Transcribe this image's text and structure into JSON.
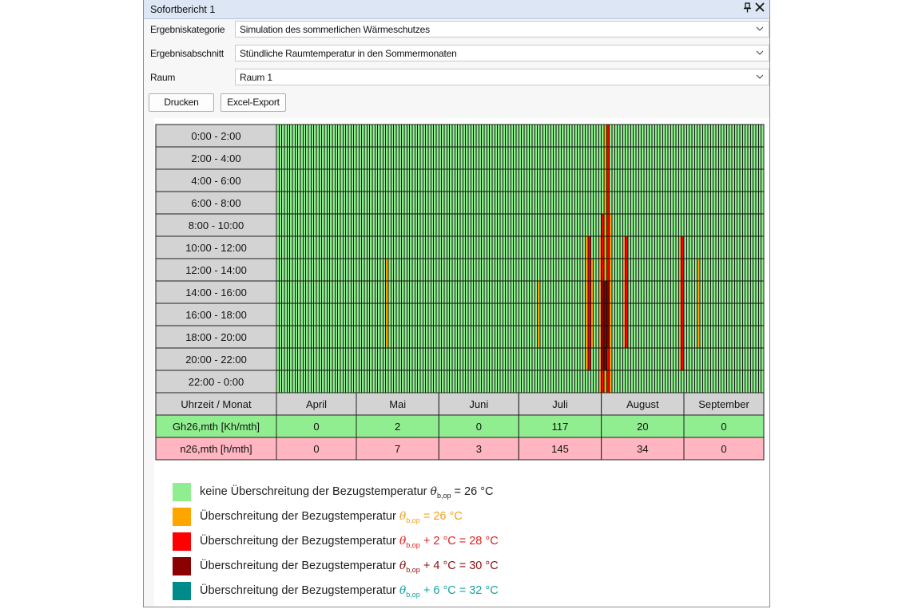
{
  "window": {
    "title": "Sofortbericht 1",
    "pin_icon": "pin-icon",
    "close_icon": "close-icon"
  },
  "filters": [
    {
      "label": "Ergebniskategorie",
      "value": "Simulation des sommerlichen Wärmeschutzes"
    },
    {
      "label": "Ergebnisabschnitt",
      "value": "Stündliche Raumtemperatur in den Sommermonaten"
    },
    {
      "label": "Raum",
      "value": "Raum 1"
    }
  ],
  "buttons": {
    "print": "Drucken",
    "export": "Excel-Export"
  },
  "colors": {
    "ok": "#90ee90",
    "over26": "#ffa500",
    "over28": "#ff0000",
    "over30": "#8b0000",
    "over32": "#008b8b",
    "grid": "#111111",
    "table_green": "#90ee90",
    "table_pink": "#ffb6c1",
    "header_grey": "#d3d3d3"
  },
  "chart_data": {
    "type": "heatmap",
    "rows": [
      "0:00 - 2:00",
      "2:00 - 4:00",
      "4:00 - 6:00",
      "6:00 - 8:00",
      "8:00 - 10:00",
      "10:00 - 12:00",
      "12:00 - 14:00",
      "14:00 - 16:00",
      "16:00 - 18:00",
      "18:00 - 20:00",
      "20:00 - 22:00",
      "22:00 - 0:00"
    ],
    "corner_label": "Uhrzeit / Monat",
    "months": [
      {
        "name": "April",
        "days": 30
      },
      {
        "name": "Mai",
        "days": 31
      },
      {
        "name": "Juni",
        "days": 30
      },
      {
        "name": "Juli",
        "days": 31
      },
      {
        "name": "August",
        "days": 31
      },
      {
        "name": "September",
        "days": 30
      }
    ],
    "exceedances": [
      {
        "day": 41,
        "from_row": 6,
        "to_row": 9,
        "level": 1
      },
      {
        "day": 98,
        "from_row": 7,
        "to_row": 9,
        "level": 1
      },
      {
        "day": 116,
        "from_row": 5,
        "to_row": 10,
        "level": 1
      },
      {
        "day": 117,
        "from_row": 5,
        "to_row": 10,
        "level": 2
      },
      {
        "day": 118,
        "from_row": 6,
        "to_row": 9,
        "level": 1
      },
      {
        "day": 121,
        "from_row": 5,
        "to_row": 11,
        "level": 1
      },
      {
        "day": 122,
        "from_row": 4,
        "to_row": 11,
        "level": 2
      },
      {
        "day": 123,
        "from_row": 0,
        "to_row": 11,
        "level": 1
      },
      {
        "day": 124,
        "from_row": 0,
        "to_row": 11,
        "level": 2
      },
      {
        "day": 125,
        "from_row": 4,
        "to_row": 11,
        "level": 1
      },
      {
        "day": 130,
        "from_row": 5,
        "to_row": 9,
        "level": 1
      },
      {
        "day": 131,
        "from_row": 5,
        "to_row": 9,
        "level": 2
      },
      {
        "day": 151,
        "from_row": 5,
        "to_row": 10,
        "level": 1
      },
      {
        "day": 152,
        "from_row": 5,
        "to_row": 10,
        "level": 2
      },
      {
        "day": 158,
        "from_row": 6,
        "to_row": 9,
        "level": 1
      },
      {
        "day": 122,
        "from_row": 7,
        "to_row": 10,
        "level": 3
      },
      {
        "day": 123,
        "from_row": 7,
        "to_row": 10,
        "level": 3
      },
      {
        "day": 124,
        "from_row": 7,
        "to_row": 9,
        "level": 3
      }
    ],
    "summary_rows": [
      {
        "label": "Gh26,mth [Kh/mth]",
        "style": "green",
        "values": [
          "0",
          "2",
          "0",
          "117",
          "20",
          "0"
        ]
      },
      {
        "label": "n26,mth [h/mth]",
        "style": "pink",
        "values": [
          "0",
          "7",
          "3",
          "145",
          "34",
          "0"
        ]
      }
    ]
  },
  "legend": [
    {
      "text": "keine Überschreitung der Bezugstemperatur",
      "symbol": "θ",
      "sub": "b,op",
      "suffix": "= 26 °C",
      "color": "#90ee90",
      "text_color": "#222222"
    },
    {
      "text": "Überschreitung der Bezugstemperatur",
      "symbol": "θ",
      "sub": "b,op",
      "suffix": "= 26 °C",
      "color": "#ffa500",
      "text_color": "#f0a020"
    },
    {
      "text": "Überschreitung der Bezugstemperatur",
      "symbol": "θ",
      "sub": "b,op",
      "suffix": "+ 2 °C = 28 °C",
      "color": "#ff0000",
      "text_color": "#e02020"
    },
    {
      "text": "Überschreitung der Bezugstemperatur",
      "symbol": "θ",
      "sub": "b,op",
      "suffix": "+ 4 °C = 30 °C",
      "color": "#8b0000",
      "text_color": "#8b1010"
    },
    {
      "text": "Überschreitung der Bezugstemperatur",
      "symbol": "θ",
      "sub": "b,op",
      "suffix": "+ 6 °C = 32 °C",
      "color": "#008b8b",
      "text_color": "#13a3a3"
    }
  ]
}
